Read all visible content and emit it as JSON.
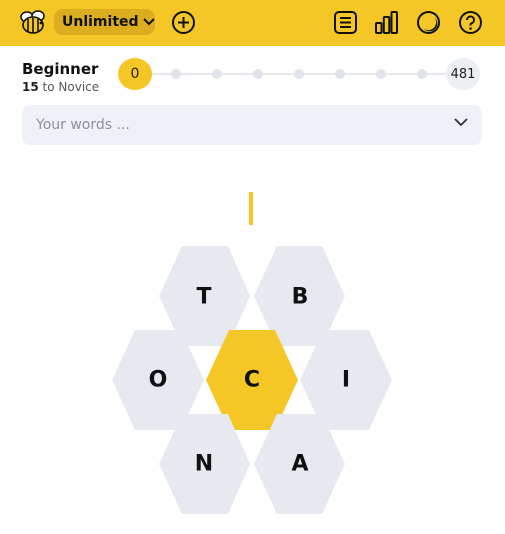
{
  "header": {
    "mode_label": "Unlimited",
    "icons": [
      "bee-logo-icon",
      "chevron-down-icon",
      "add-circle-icon",
      "list-icon",
      "stats-icon",
      "theme-icon",
      "help-icon"
    ],
    "accent_color": "#f5c726"
  },
  "rank": {
    "title": "Beginner",
    "points_needed": "15",
    "next_rank_text": "to Novice",
    "current_score": "0",
    "max_score": "481",
    "progress_steps": 9,
    "current_step": 0
  },
  "words": {
    "placeholder": "Your words ..."
  },
  "hive": {
    "center_letter": "C",
    "outer_letters": [
      "T",
      "B",
      "O",
      "I",
      "N",
      "A"
    ],
    "center_color": "#f5c726",
    "outer_color": "#e6e9f0"
  }
}
